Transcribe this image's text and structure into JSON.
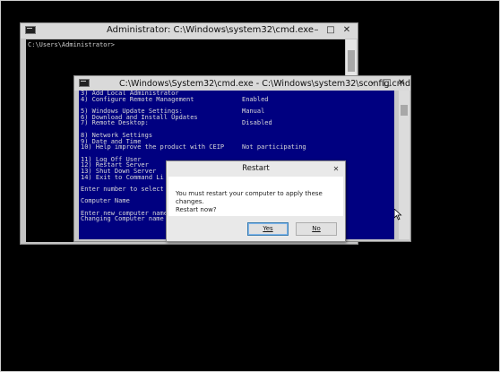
{
  "cmd_window": {
    "title": "Administrator: C:\\Windows\\system32\\cmd.exe",
    "prompt": "C:\\Users\\Administrator>"
  },
  "sconfig_window": {
    "title": "C:\\Windows\\System32\\cmd.exe - C:\\Windows\\system32\\sconfig.cmd",
    "lines": [
      {
        "text": "3) Add Local Administrator",
        "value": ""
      },
      {
        "text": "4) Configure Remote Management",
        "value": "Enabled"
      },
      {
        "text": "",
        "value": ""
      },
      {
        "text": "5) Windows Update Settings:",
        "value": "Manual"
      },
      {
        "text": "6) Download and Install Updates",
        "value": ""
      },
      {
        "text": "7) Remote Desktop:",
        "value": "Disabled"
      },
      {
        "text": "",
        "value": ""
      },
      {
        "text": "8) Network Settings",
        "value": ""
      },
      {
        "text": "9) Date and Time",
        "value": ""
      },
      {
        "text": "10) Help improve the product with CEIP",
        "value": "Not participating"
      },
      {
        "text": "",
        "value": ""
      },
      {
        "text": "11) Log Off User",
        "value": ""
      },
      {
        "text": "12) Restart Server",
        "value": ""
      },
      {
        "text": "13) Shut Down Server",
        "value": ""
      },
      {
        "text": "14) Exit to Command Li",
        "value": ""
      },
      {
        "text": "",
        "value": ""
      },
      {
        "text": "Enter number to select",
        "value": ""
      },
      {
        "text": "",
        "value": ""
      },
      {
        "text": "Computer Name",
        "value": ""
      },
      {
        "text": "",
        "value": ""
      },
      {
        "text": "Enter new computer name",
        "value": ""
      },
      {
        "text": "Changing Computer name",
        "value": ""
      }
    ]
  },
  "dialog": {
    "title": "Restart",
    "message_line1": "You must restart your computer to apply these changes.",
    "message_line2": "Restart now?",
    "yes_label": "Yes",
    "no_label": "No"
  },
  "icons": {
    "close": "✕",
    "minimize": "–",
    "maximize": "□"
  }
}
